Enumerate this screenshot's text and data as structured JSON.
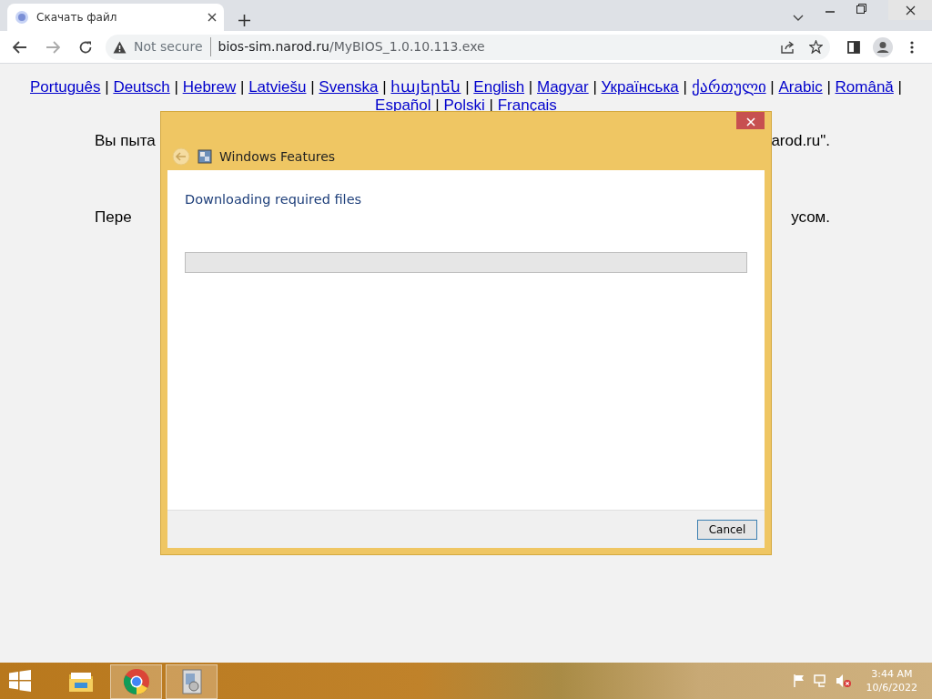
{
  "browser": {
    "tab": {
      "title": "Скачать файл",
      "selected": true
    },
    "address": {
      "security": "Not secure",
      "host": "bios-sim.narod.ru",
      "path": "/MyBIOS_1.0.10.113.exe"
    }
  },
  "page": {
    "language_lines": [
      [
        {
          "label": "Português",
          "sep": "|"
        },
        {
          "label": "Deutsch",
          "sep": "|"
        },
        {
          "label": "Hebrew",
          "sep": "|"
        },
        {
          "label": "Latviešu",
          "sep": "|"
        },
        {
          "label": "Svenska",
          "sep": "|"
        },
        {
          "label": "հայերեն",
          "sep": "|"
        },
        {
          "label": "English",
          "sep": "|"
        },
        {
          "label": "Magyar",
          "sep": "|"
        },
        {
          "label": "Українська",
          "sep": "|"
        },
        {
          "label": "ქართული",
          "sep": "|"
        },
        {
          "label": "Arabic",
          "sep": "|"
        },
        {
          "label": "Română",
          "sep": "|"
        }
      ],
      [
        {
          "label": "Español",
          "sep": "|"
        },
        {
          "label": "Polski",
          "sep": "|"
        },
        {
          "label": "Français"
        }
      ]
    ],
    "paragraphs": [
      {
        "left": "Вы пыта",
        "right": "arod.ru\"."
      },
      {
        "left": "Пере",
        "right": "усом."
      }
    ]
  },
  "dialog": {
    "title": "Windows Features",
    "heading": "Downloading required files",
    "progress": {
      "level": 0
    },
    "buttons": [
      "Cancel"
    ]
  },
  "taskbar": {
    "apps": [
      {
        "kind": "explorer",
        "active": false
      },
      {
        "kind": "chrome",
        "active": true
      },
      {
        "kind": "installer",
        "active": true
      }
    ],
    "time": "3:44 AM",
    "date": "10/6/2022"
  }
}
